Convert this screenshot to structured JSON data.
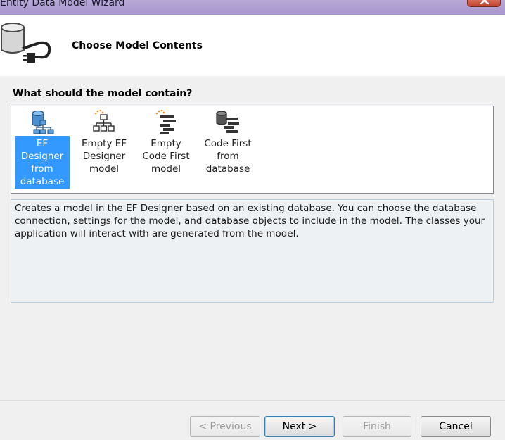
{
  "window": {
    "title": "Entity Data Model Wizard"
  },
  "header": {
    "title": "Choose Model Contents"
  },
  "question": "What should the model contain?",
  "options": [
    {
      "label": "EF Designer from database",
      "icon": "database-schema-icon",
      "selected": true
    },
    {
      "label": "Empty EF Designer model",
      "icon": "hierarchy-icon",
      "selected": false
    },
    {
      "label": "Empty Code First model",
      "icon": "code-first-icon",
      "selected": false
    },
    {
      "label": "Code First from database",
      "icon": "database-code-icon",
      "selected": false
    }
  ],
  "description": "Creates a model in the EF Designer based on an existing database. You can choose the database connection, settings for the model, and database objects to include in the model. The classes your application will interact with are generated from the model.",
  "buttons": {
    "previous": "< Previous",
    "next": "Next >",
    "finish": "Finish",
    "cancel": "Cancel"
  },
  "colors": {
    "selection": "#3399ff",
    "titlebar": "#a796cc",
    "close": "#c0402b"
  }
}
